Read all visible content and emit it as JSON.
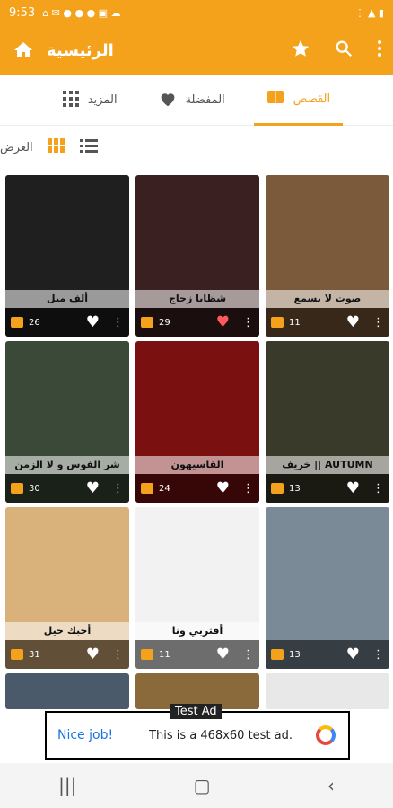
{
  "status": {
    "time": "9:53",
    "icons": [
      "home",
      "mail",
      "fb",
      "fb",
      "fb",
      "image",
      "cloud"
    ],
    "right": [
      "wifi",
      "signal",
      "battery"
    ]
  },
  "app_bar": {
    "title": "الرئيسية"
  },
  "tabs": [
    {
      "label": "القصص",
      "icon": "book-icon",
      "active": true
    },
    {
      "label": "المفضلة",
      "icon": "heart-icon",
      "active": false
    },
    {
      "label": "المزيد",
      "icon": "grid-icon",
      "active": false
    }
  ],
  "view": {
    "label": "العرض"
  },
  "cards": [
    {
      "title": "ألف ميل",
      "count": "26",
      "fav": false,
      "bg": "#1f1f1f"
    },
    {
      "title": "شظايا زجاج",
      "count": "29",
      "fav": true,
      "bg": "#3a2020"
    },
    {
      "title": "صوت لا يسمع",
      "count": "11",
      "fav": false,
      "bg": "#7a5a3a"
    },
    {
      "title": "شر الفوس و لا الزمن",
      "count": "30",
      "fav": false,
      "bg": "#3b4a38"
    },
    {
      "title": "القاسيهون",
      "count": "24",
      "fav": false,
      "bg": "#7b1010"
    },
    {
      "title": "AUTUMN || خريف",
      "count": "13",
      "fav": false,
      "bg": "#3a3a2a"
    },
    {
      "title": "أحبك حيل",
      "count": "31",
      "fav": false,
      "bg": "#d8b27a"
    },
    {
      "title": "أقتربي ونا",
      "count": "11",
      "fav": false,
      "bg": "#f2f2f2"
    },
    {
      "title": "",
      "count": "13",
      "fav": false,
      "bg": "#7a8a96"
    }
  ],
  "ad": {
    "tag": "Test Ad",
    "nice": "Nice job!",
    "message": "This is a 468x60 test ad."
  }
}
